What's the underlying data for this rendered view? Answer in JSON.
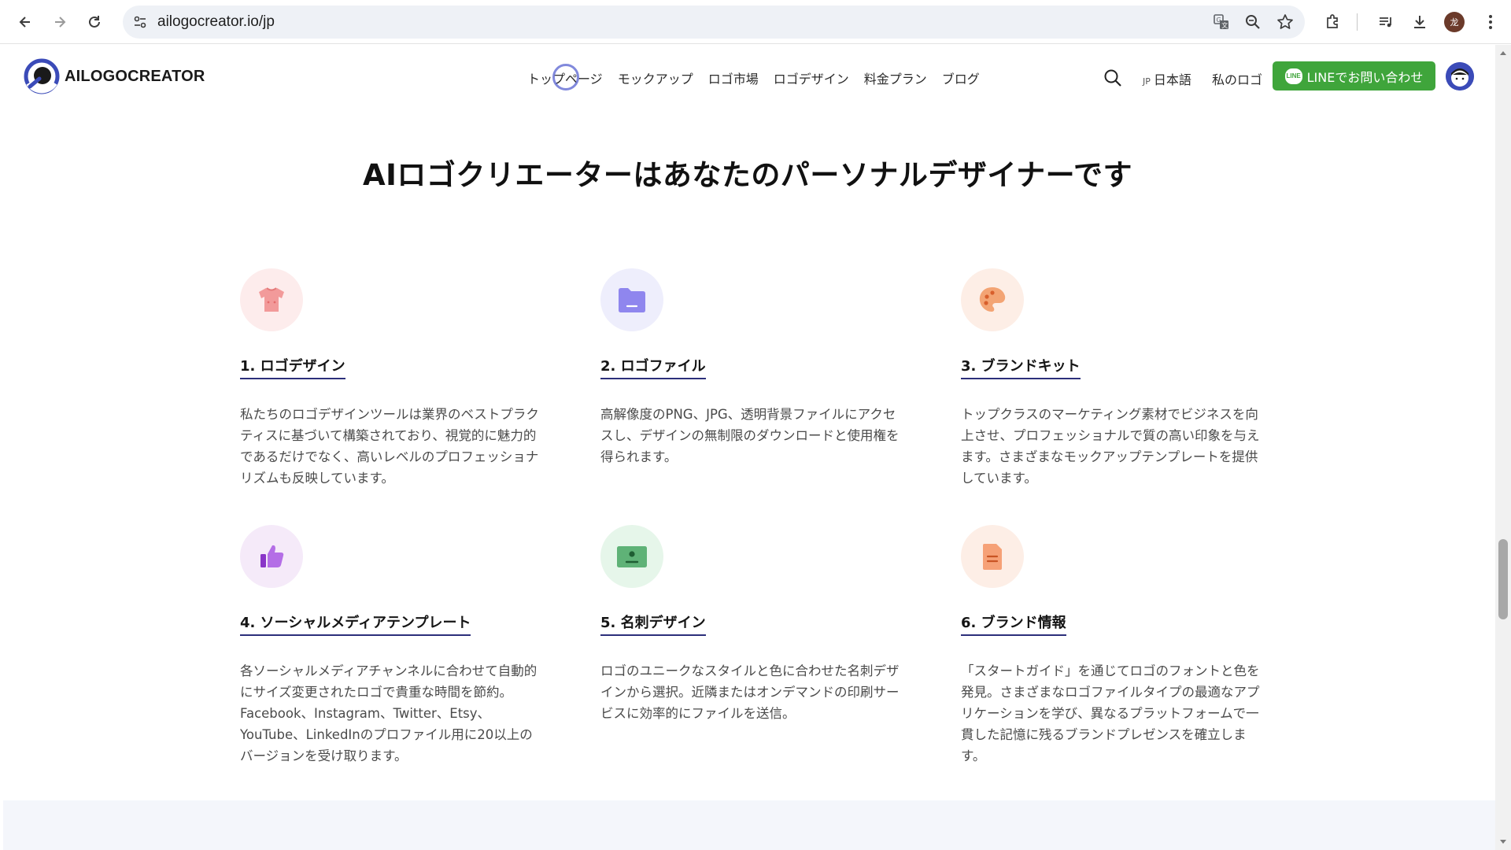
{
  "browser": {
    "url": "ailogocreator.io/jp",
    "profile_initial": "龙"
  },
  "header": {
    "logo_text": "AILOGOCREATOR",
    "nav": [
      "トップページ",
      "モックアップ",
      "ロゴ市場",
      "ロゴデザイン",
      "料金プラン",
      "ブログ"
    ],
    "lang_code": "JP",
    "lang_label": "日本語",
    "my_logo": "私のロゴ",
    "line_badge": "LINE",
    "line_button": "LINEでお問い合わせ"
  },
  "main": {
    "title": "AIロゴクリエーターはあなたのパーソナルデザイナーです",
    "features": [
      {
        "icon": "tshirt-icon",
        "title": "1. ロゴデザイン",
        "desc": "私たちのロゴデザインツールは業界のベストプラクティスに基づいて構築されており、視覚的に魅力的であるだけでなく、高いレベルのプロフェッショナリズムも反映しています。"
      },
      {
        "icon": "folder-icon",
        "title": "2. ロゴファイル",
        "desc": "高解像度のPNG、JPG、透明背景ファイルにアクセスし、デザインの無制限のダウンロードと使用権を得られます。"
      },
      {
        "icon": "palette-icon",
        "title": "3. ブランドキット",
        "desc": "トップクラスのマーケティング素材でビジネスを向上させ、プロフェッショナルで質の高い印象を与えます。さまざまなモックアップテンプレートを提供しています。"
      },
      {
        "icon": "thumbs-up-icon",
        "title": "4. ソーシャルメディアテンプレート",
        "desc": "各ソーシャルメディアチャンネルに合わせて自動的にサイズ変更されたロゴで貴重な時間を節約。Facebook、Instagram、Twitter、Etsy、YouTube、LinkedInのプロファイル用に20以上のバージョンを受け取ります。"
      },
      {
        "icon": "business-card-icon",
        "title": "5. 名刺デザイン",
        "desc": "ロゴのユニークなスタイルと色に合わせた名刺デザインから選択。近隣またはオンデマンドの印刷サービスに効率的にファイルを送信。"
      },
      {
        "icon": "document-icon",
        "title": "6. ブランド情報",
        "desc": "「スタートガイド」を通じてロゴのフォントと色を発見。さまざまなロゴファイルタイプの最適なアプリケーションを学び、異なるプラットフォームで一貫した記憶に残るブランドプレゼンスを確立します。"
      }
    ]
  },
  "colors": {
    "line_green": "#3fa53b",
    "underline_navy": "#2c2f7a",
    "brand_blue": "#3b4bb8",
    "icon_bg_pink": "#fdecec",
    "icon_bg_lavender": "#eeeefc",
    "icon_bg_peach": "#fdeee6",
    "icon_bg_purple": "#f5eaf9",
    "icon_bg_mint": "#e6f6ea"
  }
}
